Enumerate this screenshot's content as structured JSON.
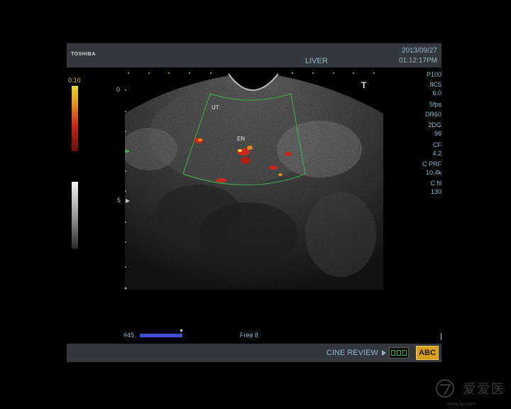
{
  "header": {
    "brand": "TOSHIBA",
    "preset": "LIVER",
    "date": "2013/09/27",
    "time": "01:12:17PM"
  },
  "colors": {
    "panel": "#34373b",
    "accent_text": "#8fb6c8",
    "doppler_red": "#c8281a",
    "doppler_yellow": "#e7dc2a",
    "abc_button": "#d8a01e",
    "frame_bar": "#3d4fd0",
    "roi_box": "#3fb24a"
  },
  "scale": {
    "color_max": "0.10",
    "depth_0": "0",
    "depth_5": "5"
  },
  "params": [
    "P100",
    "8C5",
    "6.0",
    "5fps",
    "DR60",
    "2DG",
    "96",
    "CF",
    "4.2",
    "C PRF",
    "10.4k",
    "C fil",
    "130"
  ],
  "labels": {
    "ut": "UT",
    "en": "EN",
    "t_marker": "T"
  },
  "frame": {
    "number": "#45",
    "progress": 1.0,
    "free": "Free 8"
  },
  "footer": {
    "cine_review": "CINE REVIEW",
    "abc": "ABC"
  },
  "watermark": {
    "text": "爱爱医",
    "site": "www.iiyi.com"
  }
}
